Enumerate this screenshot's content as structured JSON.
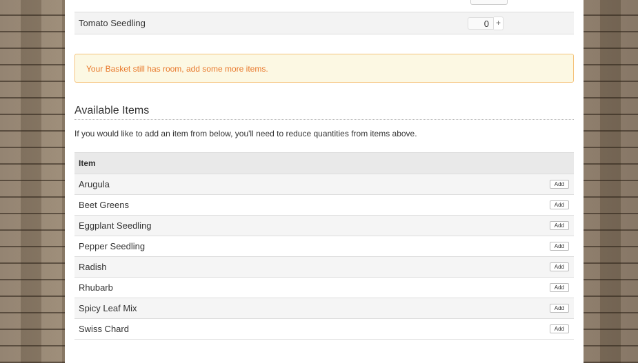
{
  "basket": {
    "selected_item": {
      "name": "Tomato Seedling",
      "quantity": "0",
      "increment_symbol": "+"
    }
  },
  "alert": {
    "message": "Your Basket still has room, add some more items."
  },
  "available": {
    "title": "Available Items",
    "note": "If you would like to add an item from below, you'll need to reduce quantities from items above.",
    "column_header": "Item",
    "add_label": "Add",
    "items": [
      {
        "name": "Arugula"
      },
      {
        "name": "Beet Greens"
      },
      {
        "name": "Eggplant Seedling"
      },
      {
        "name": "Pepper Seedling"
      },
      {
        "name": "Radish"
      },
      {
        "name": "Rhubarb"
      },
      {
        "name": "Spicy Leaf Mix"
      },
      {
        "name": "Swiss Chard"
      }
    ]
  },
  "colors": {
    "alert_text": "#e8782b",
    "alert_bg": "#fcf8e3",
    "alert_border": "#f5c27a"
  }
}
